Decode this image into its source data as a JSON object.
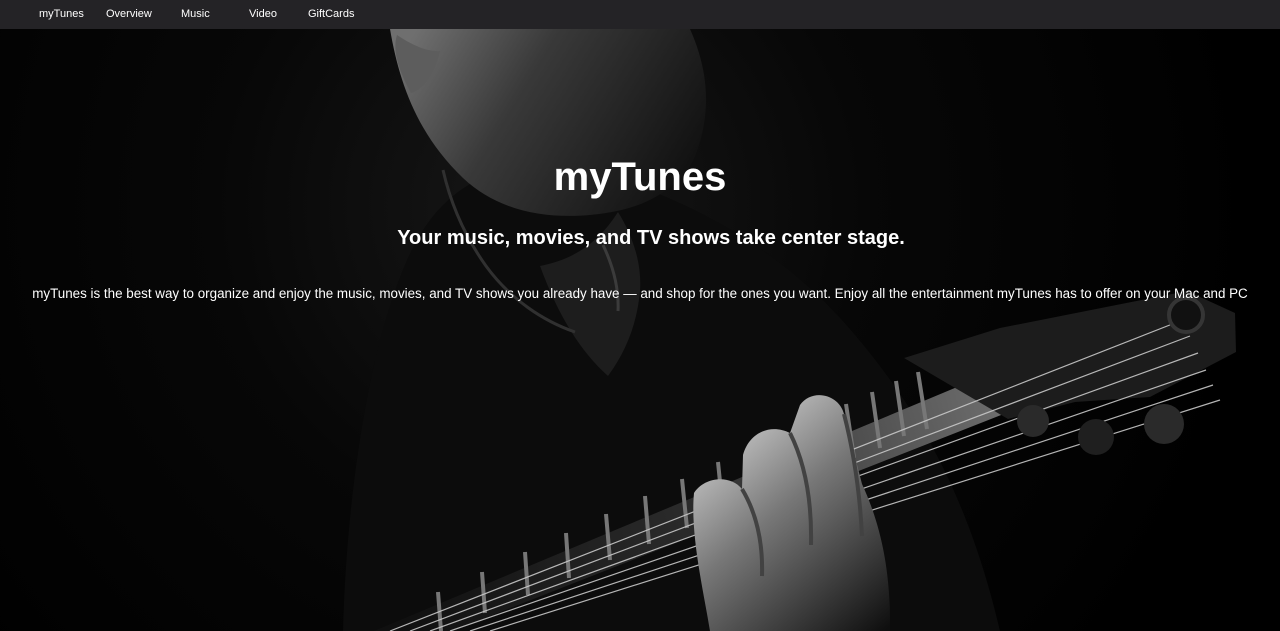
{
  "navigation": {
    "brand": "myTunes",
    "items": [
      {
        "label": "Overview"
      },
      {
        "label": "Music"
      },
      {
        "label": "Video"
      },
      {
        "label": "GiftCards"
      }
    ]
  },
  "hero": {
    "title": "myTunes",
    "subtitle": "Your music, movies, and TV shows take center stage.",
    "description": "myTunes is the best way to organize and enjoy the music, movies, and TV shows you already have — and shop for the ones you want. Enjoy all the entertainment myTunes has to offer on your Mac and PC",
    "background_image": "black-and-white-guitar-player-photo"
  },
  "colors": {
    "navbar": "#242326",
    "text": "#ffffff",
    "background": "#000000"
  }
}
